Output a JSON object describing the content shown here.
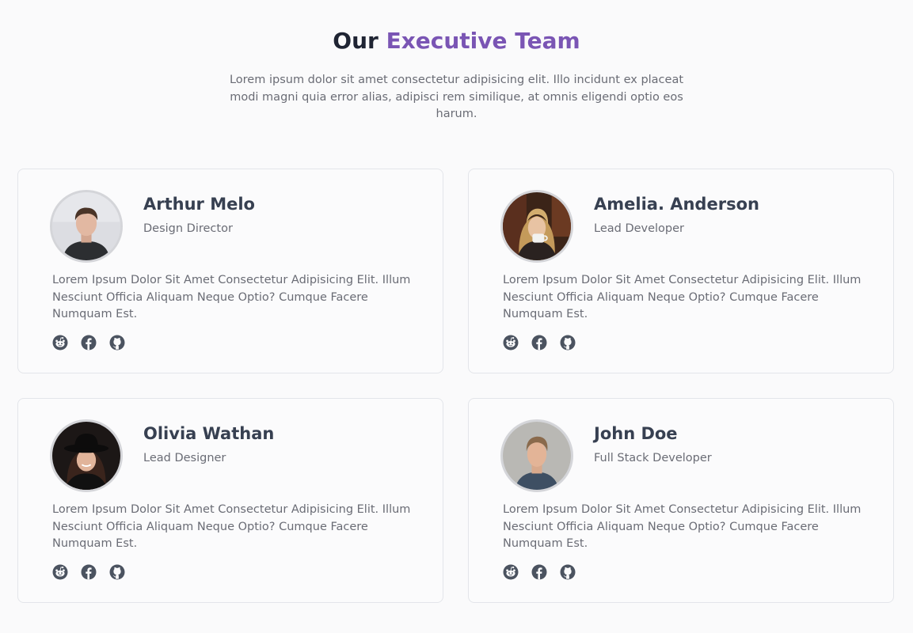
{
  "section": {
    "title_plain": "Our",
    "title_accent": "Executive Team",
    "intro": "Lorem ipsum dolor sit amet consectetur adipisicing elit. Illo incidunt ex placeat modi magni quia error alias, adipisci rem similique, at omnis eligendi optio eos harum."
  },
  "colors": {
    "accent": "#7a55b4",
    "heading": "#1f2433",
    "name": "#374051",
    "muted_text": "#6a6c75",
    "icon": "#4b5360",
    "card_border": "#e3e5ea",
    "page_background": "#fafafb"
  },
  "members": [
    {
      "name": "Arthur Melo",
      "role": "Design Director",
      "bio": "Lorem Ipsum Dolor Sit Amet Consectetur Adipisicing Elit. Illum Nesciunt Officia Aliquam Neque Optio? Cumque Facere Numquam Est.",
      "socials": [
        "reddit-icon",
        "facebook-icon",
        "github-icon"
      ]
    },
    {
      "name": "Amelia. Anderson",
      "role": "Lead Developer",
      "bio": "Lorem Ipsum Dolor Sit Amet Consectetur Adipisicing Elit. Illum Nesciunt Officia Aliquam Neque Optio? Cumque Facere Numquam Est.",
      "socials": [
        "reddit-icon",
        "facebook-icon",
        "github-icon"
      ]
    },
    {
      "name": "Olivia Wathan",
      "role": "Lead Designer",
      "bio": "Lorem Ipsum Dolor Sit Amet Consectetur Adipisicing Elit. Illum Nesciunt Officia Aliquam Neque Optio? Cumque Facere Numquam Est.",
      "socials": [
        "reddit-icon",
        "facebook-icon",
        "github-icon"
      ]
    },
    {
      "name": "John Doe",
      "role": "Full Stack Developer",
      "bio": "Lorem Ipsum Dolor Sit Amet Consectetur Adipisicing Elit. Illum Nesciunt Officia Aliquam Neque Optio? Cumque Facere Numquam Est.",
      "socials": [
        "reddit-icon",
        "facebook-icon",
        "github-icon"
      ]
    }
  ]
}
